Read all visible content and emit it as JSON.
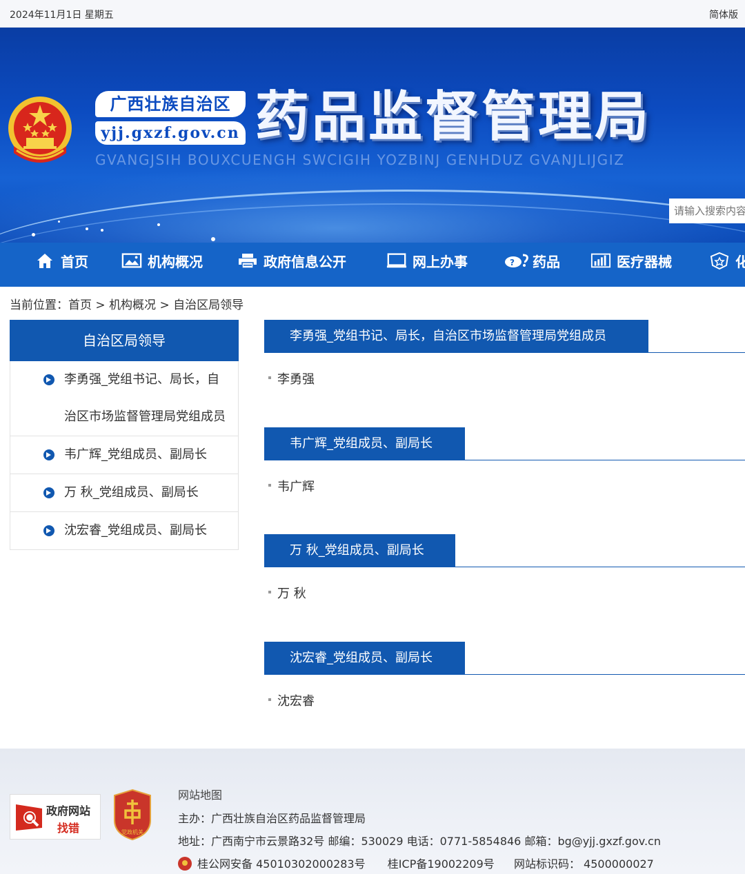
{
  "topbar": {
    "date": "2024年11月1日 星期五",
    "version": "简体版"
  },
  "banner": {
    "region": "广西壮族自治区",
    "domain": "yjj.gxzf.gov.cn",
    "title": "药品监督管理局",
    "pinyin": "GVANGJSIH BOUXCUENGH SWCIGIH YOZBINJ GENHDUZ GVANJLIJGIZ",
    "search_placeholder": "请输入搜索内容"
  },
  "nav": {
    "items": [
      {
        "label": "首页",
        "icon": "home-icon"
      },
      {
        "label": "机构概况",
        "icon": "picture-icon"
      },
      {
        "label": "政府信息公开",
        "icon": "printer-icon"
      },
      {
        "label": "网上办事",
        "icon": "monitor-icon"
      },
      {
        "label": "药品",
        "icon": "pill-icon"
      },
      {
        "label": "医疗器械",
        "icon": "bar-chart-icon"
      },
      {
        "label": "化",
        "icon": "shield-icon"
      }
    ]
  },
  "breadcrumb": {
    "prefix": "当前位置：",
    "items": [
      "首页",
      "机构概况",
      "自治区局领导"
    ],
    "separator": ">"
  },
  "sidebar": {
    "title": "自治区局领导",
    "items": [
      {
        "line1": "李勇强_党组书记、局长，自",
        "line2": "治区市场监督管理局党组成员"
      },
      {
        "line1": "韦广辉_党组成员、副局长"
      },
      {
        "line1": "万 秋_党组成员、副局长"
      },
      {
        "line1": "沈宏睿_党组成员、副局长"
      }
    ]
  },
  "sections": [
    {
      "title": "李勇强_党组书记、局长，自治区市场监督管理局党组成员",
      "name": "李勇强"
    },
    {
      "title": "韦广辉_党组成员、副局长",
      "name": "韦广辉"
    },
    {
      "title": "万 秋_党组成员、副局长",
      "name": "万 秋"
    },
    {
      "title": "沈宏睿_党组成员、副局长",
      "name": "沈宏睿"
    }
  ],
  "footer": {
    "find_error_line1": "政府网站",
    "find_error_line2": "找错",
    "party_badge_text": "党政机关",
    "sitemap": "网站地图",
    "sponsor": "主办：广西壮族自治区药品监督管理局",
    "address": "地址：广西南宁市云景路32号 邮编：530029 电话：0771-5854846 邮箱：bg@yjj.gxzf.gov.cn",
    "police_record": "桂公网安备 45010302000283号",
    "icp": "桂ICP备19002209号",
    "site_code": "网站标识码：  4500000027"
  },
  "colors": {
    "primary": "#1158b0",
    "nav": "#1564c8",
    "banner": "#0c4bc0",
    "error_red": "#d42a1e"
  }
}
